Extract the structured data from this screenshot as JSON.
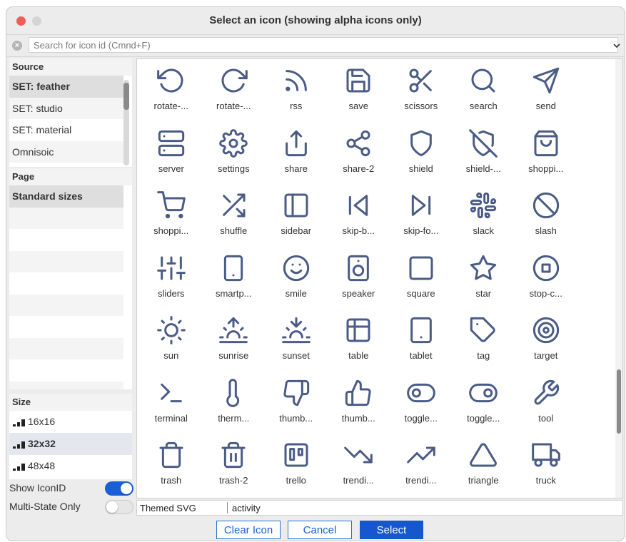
{
  "window": {
    "title": "Select an icon (showing alpha icons only)"
  },
  "search": {
    "placeholder": "Search for icon id (Cmnd+F)",
    "value": ""
  },
  "source": {
    "header": "Source",
    "items": [
      {
        "label": "SET: feather",
        "selected": true
      },
      {
        "label": "SET: studio",
        "selected": false
      },
      {
        "label": "SET: material",
        "selected": false
      },
      {
        "label": "Omnisoic",
        "selected": false
      }
    ]
  },
  "page": {
    "header": "Page",
    "items": [
      {
        "label": "Standard sizes",
        "selected": true
      }
    ]
  },
  "size": {
    "header": "Size",
    "items": [
      {
        "label": "16x16",
        "selected": false
      },
      {
        "label": "32x32",
        "selected": true
      },
      {
        "label": "48x48",
        "selected": false
      }
    ]
  },
  "toggles": {
    "show_icon_id": {
      "label": "Show IconID",
      "on": true
    },
    "multi_state_only": {
      "label": "Multi-State Only",
      "on": false
    }
  },
  "icons": [
    {
      "label": "rotate-...",
      "icon": "rotate-ccw-icon"
    },
    {
      "label": "rotate-...",
      "icon": "rotate-cw-icon"
    },
    {
      "label": "rss",
      "icon": "rss-icon"
    },
    {
      "label": "save",
      "icon": "save-icon"
    },
    {
      "label": "scissors",
      "icon": "scissors-icon"
    },
    {
      "label": "search",
      "icon": "search-icon"
    },
    {
      "label": "send",
      "icon": "send-icon"
    },
    {
      "label": "server",
      "icon": "server-icon"
    },
    {
      "label": "settings",
      "icon": "settings-icon"
    },
    {
      "label": "share",
      "icon": "share-icon"
    },
    {
      "label": "share-2",
      "icon": "share-2-icon"
    },
    {
      "label": "shield",
      "icon": "shield-icon"
    },
    {
      "label": "shield-...",
      "icon": "shield-off-icon"
    },
    {
      "label": "shoppi...",
      "icon": "shopping-bag-icon"
    },
    {
      "label": "shoppi...",
      "icon": "shopping-cart-icon"
    },
    {
      "label": "shuffle",
      "icon": "shuffle-icon"
    },
    {
      "label": "sidebar",
      "icon": "sidebar-icon"
    },
    {
      "label": "skip-b...",
      "icon": "skip-back-icon"
    },
    {
      "label": "skip-fo...",
      "icon": "skip-forward-icon"
    },
    {
      "label": "slack",
      "icon": "slack-icon"
    },
    {
      "label": "slash",
      "icon": "slash-icon"
    },
    {
      "label": "sliders",
      "icon": "sliders-icon"
    },
    {
      "label": "smartp...",
      "icon": "smartphone-icon"
    },
    {
      "label": "smile",
      "icon": "smile-icon"
    },
    {
      "label": "speaker",
      "icon": "speaker-icon"
    },
    {
      "label": "square",
      "icon": "square-icon"
    },
    {
      "label": "star",
      "icon": "star-icon"
    },
    {
      "label": "stop-c...",
      "icon": "stop-circle-icon"
    },
    {
      "label": "sun",
      "icon": "sun-icon"
    },
    {
      "label": "sunrise",
      "icon": "sunrise-icon"
    },
    {
      "label": "sunset",
      "icon": "sunset-icon"
    },
    {
      "label": "table",
      "icon": "table-icon"
    },
    {
      "label": "tablet",
      "icon": "tablet-icon"
    },
    {
      "label": "tag",
      "icon": "tag-icon"
    },
    {
      "label": "target",
      "icon": "target-icon"
    },
    {
      "label": "terminal",
      "icon": "terminal-icon"
    },
    {
      "label": "therm...",
      "icon": "thermometer-icon"
    },
    {
      "label": "thumb...",
      "icon": "thumbs-down-icon"
    },
    {
      "label": "thumb...",
      "icon": "thumbs-up-icon"
    },
    {
      "label": "toggle...",
      "icon": "toggle-left-icon"
    },
    {
      "label": "toggle...",
      "icon": "toggle-right-icon"
    },
    {
      "label": "tool",
      "icon": "tool-icon"
    },
    {
      "label": "trash",
      "icon": "trash-icon"
    },
    {
      "label": "trash-2",
      "icon": "trash-2-icon"
    },
    {
      "label": "trello",
      "icon": "trello-icon"
    },
    {
      "label": "trendi...",
      "icon": "trending-down-icon"
    },
    {
      "label": "trendi...",
      "icon": "trending-up-icon"
    },
    {
      "label": "triangle",
      "icon": "triangle-icon"
    },
    {
      "label": "truck",
      "icon": "truck-icon"
    }
  ],
  "status": {
    "left": "Themed SVG",
    "right": "activity"
  },
  "buttons": {
    "clear": "Clear Icon",
    "cancel": "Cancel",
    "select": "Select"
  },
  "colors": {
    "icon_stroke": "#4a5b86",
    "accent": "#1657d0",
    "close_button": "#ec5f57"
  }
}
